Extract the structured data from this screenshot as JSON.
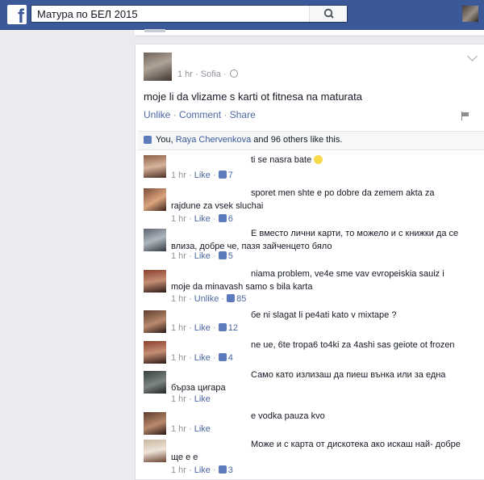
{
  "topbar": {
    "search_value": "Матура по БЕЛ 2015",
    "brand_color": "#3b5998"
  },
  "post": {
    "time": "1 hr",
    "location": "Sofia",
    "text": "moje li da vlizame s karti ot fitnesa na maturata",
    "actions": [
      "Unlike",
      "Comment",
      "Share"
    ],
    "likes_summary": {
      "prefix": "You, ",
      "name": "Raya Chervenkova",
      "suffix": " and 96 others like this."
    }
  },
  "comments": [
    {
      "text": "ti se nasra bate",
      "emoji": "smile",
      "time": "1 hr",
      "like_label": "Like",
      "likes": "7"
    },
    {
      "text": "sporet men shte e po dobre da zemem akta za rajdune za vsek sluchai",
      "time": "1 hr",
      "like_label": "Like",
      "likes": "6"
    },
    {
      "text": "Е вместо лични карти, то можело и с книжки да се влиза, добре че, пазя зайченцето бяло",
      "time": "1 hr",
      "like_label": "Like",
      "likes": "5"
    },
    {
      "text": "niama problem, ve4e sme vav evropeiskia sauiz i moje da minavash samo s bila karta",
      "time": "1 hr",
      "like_label": "Unlike",
      "likes": "85"
    },
    {
      "text": "бе ni slagat li pe4ati kato v mixtape ?",
      "time": "1 hr",
      "like_label": "Like",
      "likes": "12"
    },
    {
      "text": "ne ue, 6te tropa6 to4ki za 4ashi sas geiote ot frozen",
      "time": "1 hr",
      "like_label": "Like",
      "likes": "4"
    },
    {
      "text": "Само като излизаш да пиеш вънка или за една бърза цигара",
      "time": "1 hr",
      "like_label": "Like",
      "likes": ""
    },
    {
      "text": "e vodka pauza kvo",
      "time": "1 hr",
      "like_label": "Like",
      "likes": ""
    },
    {
      "text": "Може и с карта от дискотека ако искаш най- добре ще е е",
      "time": "1 hr",
      "like_label": "Like",
      "likes": "3"
    }
  ]
}
